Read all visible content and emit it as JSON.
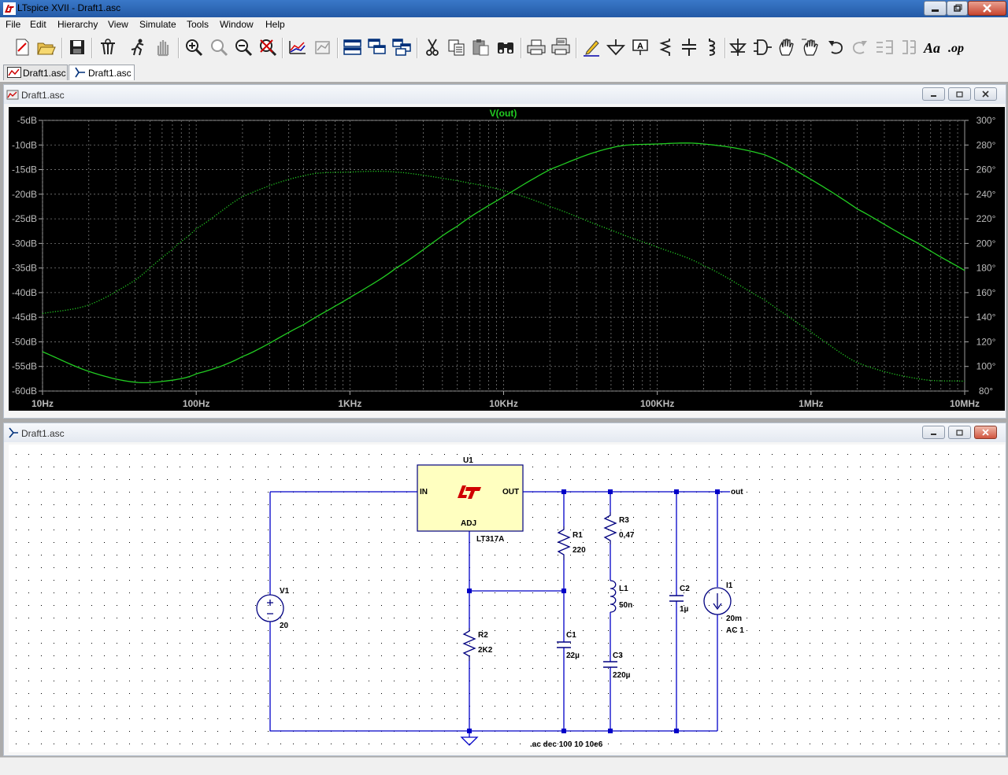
{
  "window": {
    "title": "LTspice XVII - Draft1.asc"
  },
  "menu": [
    "File",
    "Edit",
    "Hierarchy",
    "View",
    "Simulate",
    "Tools",
    "Window",
    "Help"
  ],
  "toolbar": {
    "buttons": [
      "new-schematic-icon",
      "open-icon",
      "save-icon",
      "control-panel-icon",
      "run-icon",
      "halt-icon",
      "zoom-in-icon",
      "pan-icon",
      "zoom-out-icon",
      "zoom-fit-icon",
      "autorange-icon",
      "plot-settings-icon",
      "tile-horizontal-icon",
      "cascade-icon",
      "tile-vertical-icon",
      "cut-icon",
      "copy-icon",
      "paste-icon",
      "find-icon",
      "print-icon",
      "print-setup-icon",
      "draw-wire-icon",
      "ground-icon",
      "label-net-icon",
      "resistor-icon",
      "capacitor-icon",
      "inductor-icon",
      "diode-icon",
      "component-icon",
      "move-icon",
      "drag-icon",
      "undo-icon",
      "redo-icon",
      "rotate-icon",
      "mirror-icon",
      "text-icon",
      "spice-directive-icon"
    ],
    "text_label": "Aa",
    "op_label": ".op"
  },
  "tabs": [
    {
      "label": "Draft1.asc",
      "kind": "waveform",
      "active": false
    },
    {
      "label": "Draft1.asc",
      "kind": "schematic",
      "active": true
    }
  ],
  "plot_window": {
    "title": "Draft1.asc"
  },
  "schematic_window": {
    "title": "Draft1.asc"
  },
  "chart_data": {
    "type": "line",
    "title": "V(out)",
    "x_scale": "log",
    "xlim": [
      10,
      10000000
    ],
    "x_ticks": [
      "10Hz",
      "100Hz",
      "1KHz",
      "10KHz",
      "100KHz",
      "1MHz",
      "10MHz"
    ],
    "y_left_ticks": [
      "-5dB",
      "-10dB",
      "-15dB",
      "-20dB",
      "-25dB",
      "-30dB",
      "-35dB",
      "-40dB",
      "-45dB",
      "-50dB",
      "-55dB",
      "-60dB"
    ],
    "y_left_lim": [
      -60,
      -5
    ],
    "y_right_ticks": [
      "300°",
      "280°",
      "260°",
      "240°",
      "220°",
      "200°",
      "180°",
      "160°",
      "140°",
      "120°",
      "100°",
      "80°"
    ],
    "y_right_lim": [
      80,
      300
    ],
    "grid": true,
    "trace_color": "#22cc22",
    "series": [
      {
        "name": "magnitude",
        "style": "solid",
        "axis": "left",
        "x": [
          10,
          20,
          40,
          70,
          100,
          200,
          500,
          1000,
          2000,
          5000,
          10000,
          20000,
          50000,
          100000,
          200000,
          500000,
          1000000,
          2000000,
          5000000,
          10000000
        ],
        "y": [
          -52,
          -56,
          -58.2,
          -57.8,
          -56.5,
          -53,
          -46.5,
          -41,
          -35,
          -26.5,
          -20.5,
          -15,
          -10.6,
          -9.8,
          -9.8,
          -12,
          -17,
          -23,
          -30,
          -35.5
        ]
      },
      {
        "name": "phase",
        "style": "dotted",
        "axis": "right",
        "x": [
          10,
          20,
          40,
          70,
          100,
          200,
          500,
          1000,
          2000,
          5000,
          10000,
          20000,
          50000,
          100000,
          200000,
          500000,
          1000000,
          2000000,
          5000000,
          10000000
        ],
        "y": [
          143,
          150,
          170,
          195,
          212,
          238,
          255,
          258,
          258,
          251,
          243,
          230,
          211,
          197,
          182,
          154,
          128,
          103,
          90,
          88
        ]
      }
    ]
  },
  "schematic": {
    "u1_name": "U1",
    "u1_part": "LT317A",
    "pin_in": "IN",
    "pin_out": "OUT",
    "pin_adj": "ADJ",
    "logo": "LT",
    "net_out": "out",
    "v1": {
      "name": "V1",
      "value": "20"
    },
    "r1": {
      "name": "R1",
      "value": "220"
    },
    "r2": {
      "name": "R2",
      "value": "2K2"
    },
    "r3": {
      "name": "R3",
      "value": "0,47"
    },
    "l1": {
      "name": "L1",
      "value": "50n"
    },
    "c1": {
      "name": "C1",
      "value": "22µ"
    },
    "c2": {
      "name": "C2",
      "value": "1µ"
    },
    "c3": {
      "name": "C3",
      "value": "220µ"
    },
    "i1": {
      "name": "I1",
      "value": "20m",
      "ac": "AC 1"
    },
    "directive": ".ac dec 100 10 10e6",
    "wire_color": "#0000c8",
    "component_color": "#000080",
    "ic_fill": "#ffffc0"
  }
}
